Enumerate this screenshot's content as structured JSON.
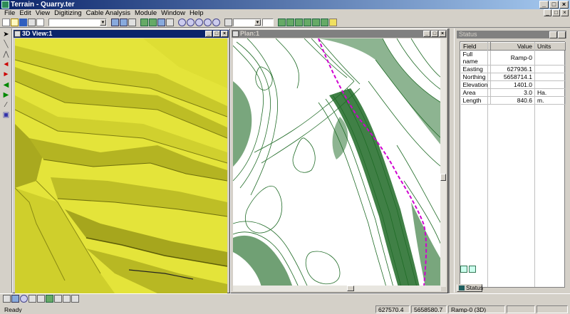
{
  "app": {
    "title": "Terrain - Quarry.ter",
    "minimize": "_",
    "maximize": "□",
    "close": "×"
  },
  "menu": [
    "File",
    "Edit",
    "View",
    "Digitizing",
    "Cable Analysis",
    "Module",
    "Window",
    "Help"
  ],
  "toolbar": {
    "combo1_value": "",
    "combo2_value": "",
    "combo3_value": ""
  },
  "windows": {
    "view3d_title": "3D View:1",
    "plan_title": "Plan:1"
  },
  "status_panel": {
    "title": "Status",
    "columns": [
      "Field",
      "Value",
      "Units"
    ],
    "rows": [
      {
        "field": "Full name",
        "value": "Ramp-0",
        "units": ""
      },
      {
        "field": "Easting",
        "value": "627936.1",
        "units": ""
      },
      {
        "field": "Northing",
        "value": "5658714.1",
        "units": ""
      },
      {
        "field": "Elevation",
        "value": "1401.0",
        "units": ""
      },
      {
        "field": "Area",
        "value": "3.0",
        "units": "Ha."
      },
      {
        "field": "Length",
        "value": "840.6",
        "units": "m."
      }
    ],
    "tab_label": "Status"
  },
  "statusbar": {
    "ready": "Ready",
    "easting": "627570.4",
    "northing": "5658580.7",
    "object": "Ramp-0 (3D)"
  },
  "colors": {
    "terrain_yellow": "#e4e43a",
    "contour_green": "#1f6b26",
    "ramp_line": "#d000d0",
    "title_active": "#0a246a"
  }
}
